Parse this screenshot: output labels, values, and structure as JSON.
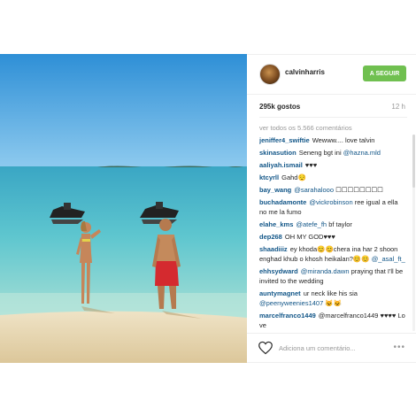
{
  "post": {
    "username": "calvinharris",
    "follow_label": "A SEGUIR",
    "likes": "295k gostos",
    "time": "12 h",
    "view_all": "ver todos os 5.566 comentários",
    "add_comment_placeholder": "Adiciona um comentário...",
    "more_label": "•••"
  },
  "comments": [
    {
      "user": "jeniffer4_swiftie",
      "text": "Wewww.... love talvin"
    },
    {
      "user": "skinasution",
      "text": "Seneng bgt ini ",
      "mention": "@hazna.mld"
    },
    {
      "user": "aaliyah.ismail",
      "text": "♥♥♥"
    },
    {
      "user": "ktcyrll",
      "text": "Gahd😌"
    },
    {
      "user": "bay_wang",
      "mention": "@sarahalooo",
      "text": " ☐☐☐☐☐☐☐☐"
    },
    {
      "user": "buchadamonte",
      "mention": "@vickrobinson",
      "text": " ree igual a ella no me la fumo"
    },
    {
      "user": "elahe_kms",
      "mention": "@atefe_fh",
      "text": " bf taylor"
    },
    {
      "user": "dep268",
      "text": "OH MY GOD♥♥♥"
    },
    {
      "user": "shaadiiiz",
      "text": "ey khoda😊😊chera ina har 2 shoon enghad khub o khosh heikalan?😊😊 ",
      "mention": "@_asal_ft_"
    },
    {
      "user": "ehhsydward",
      "mention": "@miranda.dawn",
      "text": " praying that I'll be invited to the wedding"
    },
    {
      "user": "auntymagnet",
      "text": "ur neck like his sia ",
      "mention": "@peenyweenies1407 😺😺"
    },
    {
      "user": "marcelfranco1449",
      "mention": "",
      "text": "@marcelfranco1449 ♥♥♥♥ Lo ve"
    }
  ],
  "icons": {
    "avatar": "avatar-photo",
    "heart": "heart-outline-icon",
    "more": "more-dots-icon"
  },
  "colors": {
    "follow": "#70c050",
    "username_link": "#125688",
    "muted": "#999999"
  }
}
